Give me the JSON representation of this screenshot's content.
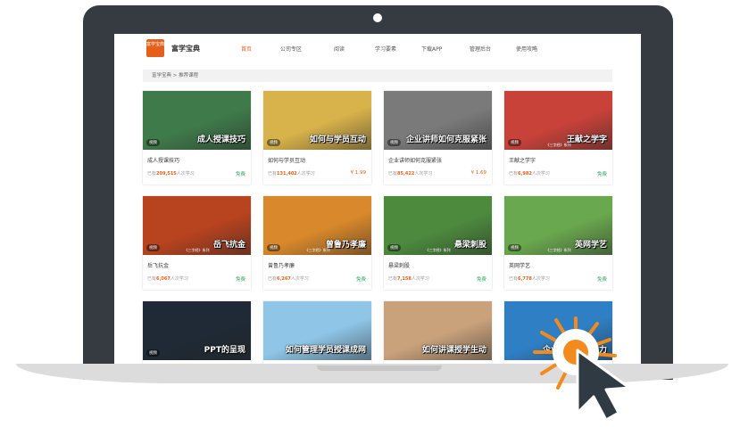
{
  "site": {
    "logo_text": "富学宝典",
    "name": "富学宝典"
  },
  "nav": [
    {
      "label": "首页",
      "active": true
    },
    {
      "label": "公司专区",
      "active": false
    },
    {
      "label": "阅读",
      "active": false
    },
    {
      "label": "学习要素",
      "active": false
    },
    {
      "label": "下载APP",
      "active": false
    },
    {
      "label": "管理后台",
      "active": false
    },
    {
      "label": "使用攻略",
      "active": false
    }
  ],
  "breadcrumb": "富学宝典 > 推荐课程",
  "colors": {
    "accent": "#e35f1a",
    "free": "#2aa55a",
    "bezel": "#353b40"
  },
  "cards": [
    {
      "thumb_title": "成人授课技巧",
      "thumb_sub": "",
      "tag": "视频",
      "title": "成人授课技巧",
      "meta_prefix": "已有",
      "meta_num": "209,515",
      "meta_suffix": "人次学习",
      "price": "免费",
      "free": true,
      "bg": "#3f7a4a"
    },
    {
      "thumb_title": "如何与学员互动",
      "thumb_sub": "",
      "tag": "视频",
      "title": "如何与学员互动",
      "meta_prefix": "已有",
      "meta_num": "131,402",
      "meta_suffix": "人次学习",
      "price": "¥ 1.99",
      "free": false,
      "bg": "#d8b24a"
    },
    {
      "thumb_title": "企业讲师如何克服紧张",
      "thumb_sub": "",
      "tag": "视频",
      "title": "企业讲师如何克服紧张",
      "meta_prefix": "已有",
      "meta_num": "85,422",
      "meta_suffix": "人次学习",
      "price": "¥ 1.69",
      "free": false,
      "bg": "#7a7a7a"
    },
    {
      "thumb_title": "王献之学字",
      "thumb_sub": "《三字经》系列",
      "tag": "视频",
      "title": "王献之学字",
      "meta_prefix": "已有",
      "meta_num": "6,982",
      "meta_suffix": "人次学习",
      "price": "免费",
      "free": true,
      "bg": "#c9423a"
    },
    {
      "thumb_title": "岳飞抗金",
      "thumb_sub": "《三字经》系列",
      "tag": "视频",
      "title": "岳飞抗金",
      "meta_prefix": "已有",
      "meta_num": "6,067",
      "meta_suffix": "人次学习",
      "price": "免费",
      "free": true,
      "bg": "#b8431f"
    },
    {
      "thumb_title": "曾鲁乃孝廉",
      "thumb_sub": "《三字经》系列",
      "tag": "视频",
      "title": "曾鲁乃孝廉",
      "meta_prefix": "已有",
      "meta_num": "6,267",
      "meta_suffix": "人次学习",
      "price": "免费",
      "free": true,
      "bg": "#d9892b"
    },
    {
      "thumb_title": "悬梁刺股",
      "thumb_sub": "《三字经》系列",
      "tag": "视频",
      "title": "悬梁刺股",
      "meta_prefix": "已有",
      "meta_num": "7,158",
      "meta_suffix": "人次学习",
      "price": "免费",
      "free": true,
      "bg": "#4d8a3e"
    },
    {
      "thumb_title": "英网学艺",
      "thumb_sub": "《三字经》系列",
      "tag": "视频",
      "title": "英网学艺",
      "meta_prefix": "已有",
      "meta_num": "6,778",
      "meta_suffix": "人次学习",
      "price": "免费",
      "free": true,
      "bg": "#6aa84f"
    },
    {
      "thumb_title": "PPT的呈现",
      "thumb_sub": "",
      "tag": "视频",
      "title": "",
      "meta_prefix": "",
      "meta_num": "",
      "meta_suffix": "",
      "price": "",
      "free": true,
      "bg": "#1f2a36"
    },
    {
      "thumb_title": "如何管理学员授课成网",
      "thumb_sub": "",
      "tag": "",
      "title": "",
      "meta_prefix": "",
      "meta_num": "",
      "meta_suffix": "",
      "price": "",
      "free": true,
      "bg": "#8fc6e8"
    },
    {
      "thumb_title": "如何讲课授学生动",
      "thumb_sub": "",
      "tag": "",
      "title": "",
      "meta_prefix": "",
      "meta_num": "",
      "meta_suffix": "",
      "price": "",
      "free": true,
      "bg": "#c9a27c"
    },
    {
      "thumb_title": "企业讲师表达能力",
      "thumb_sub": "",
      "tag": "",
      "title": "",
      "meta_prefix": "",
      "meta_num": "",
      "meta_suffix": "",
      "price": "",
      "free": true,
      "bg": "#2f7fc4"
    }
  ]
}
